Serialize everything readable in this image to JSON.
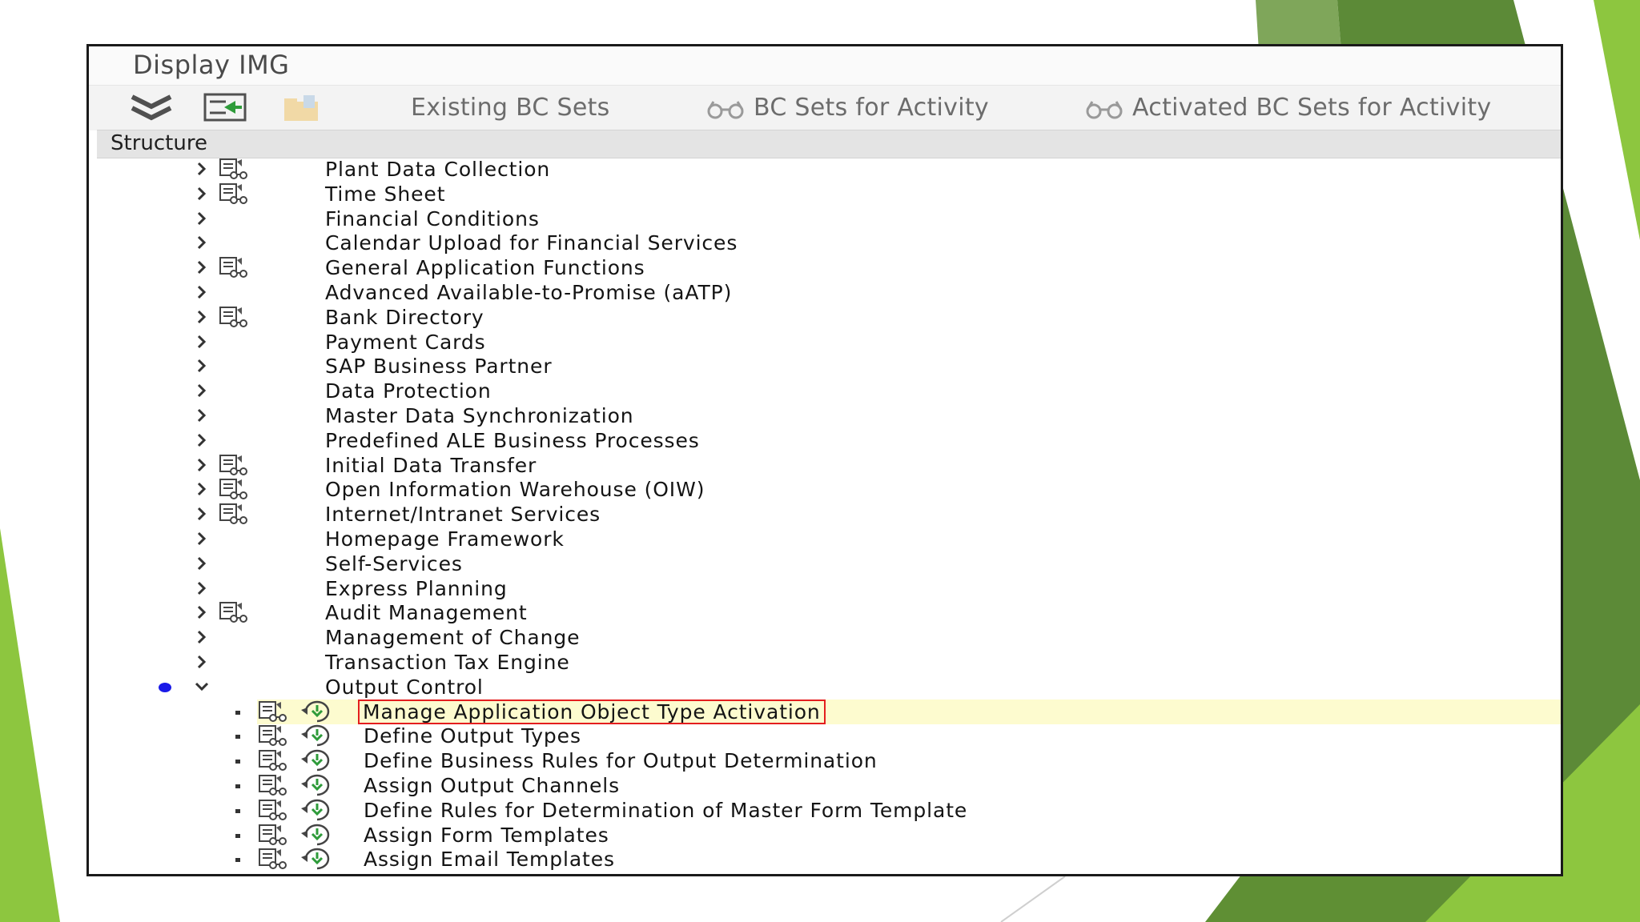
{
  "window": {
    "title": "Display IMG"
  },
  "toolbar": {
    "existing_bc_sets": "Existing BC Sets",
    "bc_sets_for_activity": "BC Sets for Activity",
    "activated_bc_sets_for_activity": "Activated BC Sets for Activity"
  },
  "structure": {
    "header": "Structure"
  },
  "tree": {
    "collapsed_nodes": [
      {
        "label": "Plant Data Collection",
        "has_bcset_icon": true
      },
      {
        "label": "Time Sheet",
        "has_bcset_icon": true
      },
      {
        "label": "Financial Conditions",
        "has_bcset_icon": false
      },
      {
        "label": "Calendar Upload for Financial Services",
        "has_bcset_icon": false
      },
      {
        "label": "General Application Functions",
        "has_bcset_icon": true
      },
      {
        "label": "Advanced Available-to-Promise (aATP)",
        "has_bcset_icon": false
      },
      {
        "label": "Bank Directory",
        "has_bcset_icon": true
      },
      {
        "label": "Payment Cards",
        "has_bcset_icon": false
      },
      {
        "label": "SAP Business Partner",
        "has_bcset_icon": false
      },
      {
        "label": "Data Protection",
        "has_bcset_icon": false
      },
      {
        "label": "Master Data Synchronization",
        "has_bcset_icon": false
      },
      {
        "label": "Predefined ALE Business Processes",
        "has_bcset_icon": false
      },
      {
        "label": "Initial Data Transfer",
        "has_bcset_icon": true
      },
      {
        "label": "Open Information Warehouse (OIW)",
        "has_bcset_icon": true
      },
      {
        "label": "Internet/Intranet Services",
        "has_bcset_icon": true
      },
      {
        "label": "Homepage Framework",
        "has_bcset_icon": false
      },
      {
        "label": "Self-Services",
        "has_bcset_icon": false
      },
      {
        "label": "Express Planning",
        "has_bcset_icon": false
      },
      {
        "label": "Audit Management",
        "has_bcset_icon": true
      },
      {
        "label": "Management of Change",
        "has_bcset_icon": false
      },
      {
        "label": "Transaction Tax Engine",
        "has_bcset_icon": false
      }
    ],
    "expanded_node": {
      "label": "Output Control"
    },
    "activities": [
      {
        "label": "Manage Application Object Type Activation",
        "selected": true
      },
      {
        "label": "Define Output Types",
        "selected": false
      },
      {
        "label": "Define Business Rules for Output Determination",
        "selected": false
      },
      {
        "label": "Assign Output Channels",
        "selected": false
      },
      {
        "label": "Define Rules for Determination of Master Form Template",
        "selected": false
      },
      {
        "label": "Assign Form Templates",
        "selected": false
      },
      {
        "label": "Assign Email Templates",
        "selected": false
      }
    ]
  },
  "colors": {
    "slide_green_dark": "#5f8f34",
    "slide_green_light": "#8dc63f",
    "selection_bg": "#fdfbcf",
    "selection_border": "#e41e1e",
    "marker_blue": "#1a1ae8"
  }
}
